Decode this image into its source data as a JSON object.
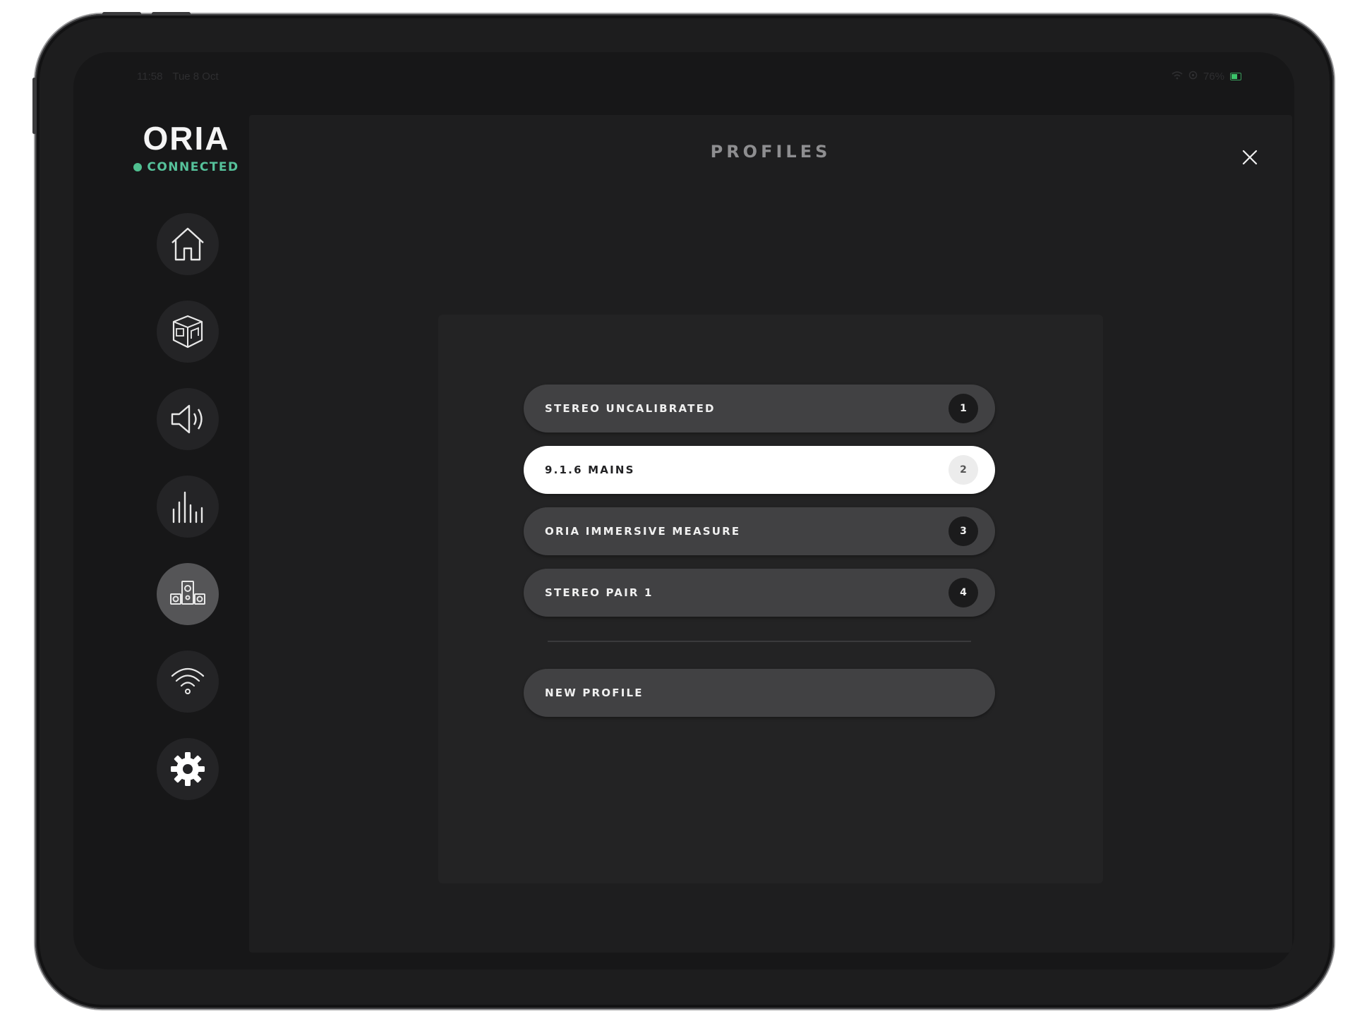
{
  "status_bar": {
    "time": "11:58",
    "date": "Tue 8 Oct",
    "battery": "76%"
  },
  "brand": {
    "title": "ORIA",
    "status": "CONNECTED",
    "status_color": "#4fbf8f"
  },
  "nav": [
    {
      "icon": "home-icon",
      "active": false
    },
    {
      "icon": "room-icon",
      "active": false
    },
    {
      "icon": "speaker-volume-icon",
      "active": false
    },
    {
      "icon": "equalizer-icon",
      "active": false
    },
    {
      "icon": "speaker-setup-icon",
      "active": true
    },
    {
      "icon": "wifi-icon",
      "active": false
    },
    {
      "icon": "gear-icon",
      "active": false
    }
  ],
  "main": {
    "title": "PROFILES",
    "profiles": [
      {
        "label": "STEREO UNCALIBRATED",
        "number": "1",
        "selected": false
      },
      {
        "label": "9.1.6 MAINS",
        "number": "2",
        "selected": true
      },
      {
        "label": "ORIA IMMERSIVE MEASURE",
        "number": "3",
        "selected": false
      },
      {
        "label": "STEREO PAIR 1",
        "number": "4",
        "selected": false
      }
    ],
    "new_profile_label": "NEW PROFILE"
  },
  "colors": {
    "accent": "#4fbf8f",
    "selected_item": "#ffffff",
    "item_bg": "#414143"
  }
}
